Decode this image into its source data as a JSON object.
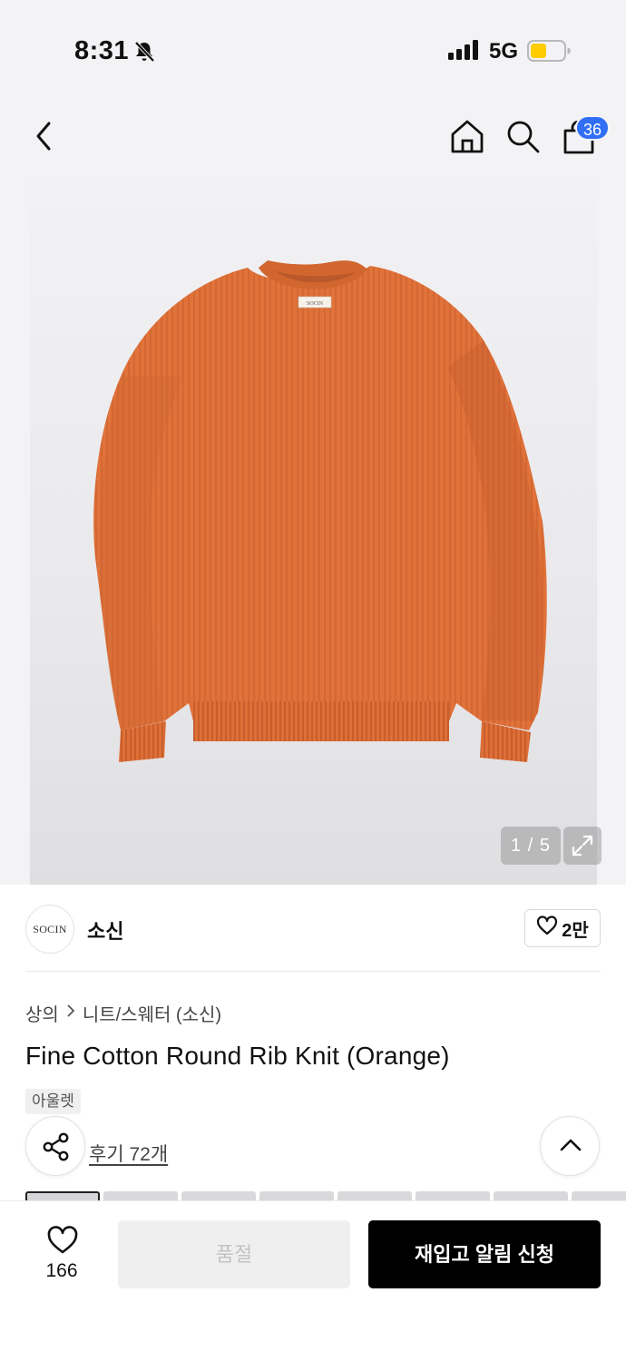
{
  "status_bar": {
    "time": "8:31",
    "network": "5G",
    "battery_color": "#FFCC00"
  },
  "nav": {
    "back_icon": "chevron-left-icon",
    "home_icon": "home-icon",
    "search_icon": "search-icon",
    "cart_icon": "shopping-bag-icon",
    "cart_count": "36",
    "badge_color": "#2F6EF5"
  },
  "gallery": {
    "image_label": "SOCIN",
    "pager": "1 / 5",
    "expand_icon": "expand-icon",
    "product_color": "#E0723A"
  },
  "brand": {
    "logo_text": "SOCIN",
    "name": "소신",
    "likes": "2만"
  },
  "product": {
    "breadcrumb": [
      "상의",
      "니트/스웨터 (소신)"
    ],
    "title": "Fine Cotton Round Rib Knit (Orange)",
    "tag": "아울렛",
    "reviews": "후기 72개"
  },
  "actions": {
    "share_icon": "share-icon",
    "scroll_top_icon": "chevron-up-icon",
    "wish_count": "166",
    "soldout_label": "품절",
    "restock_label": "재입고 알림 신청"
  }
}
